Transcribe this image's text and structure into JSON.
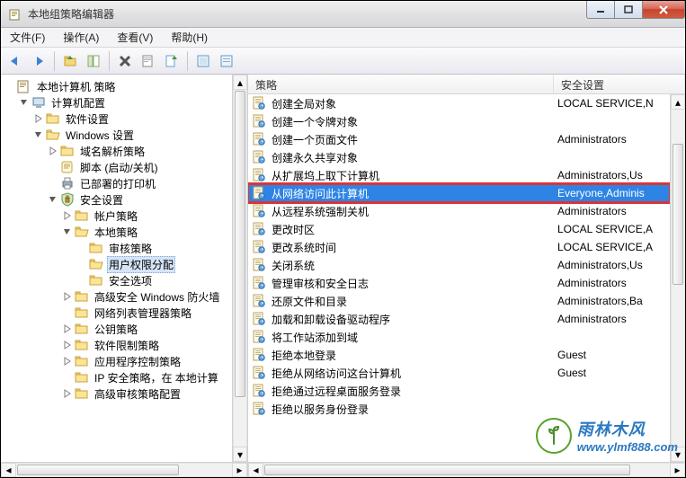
{
  "window": {
    "title": "本地组策略编辑器"
  },
  "menu": {
    "file": "文件(F)",
    "action": "操作(A)",
    "view": "查看(V)",
    "help": "帮助(H)"
  },
  "tree": {
    "root": "本地计算机 策略",
    "computer_config": "计算机配置",
    "software_settings": "软件设置",
    "windows_settings": "Windows 设置",
    "dns_policy": "域名解析策略",
    "scripts": "脚本 (启动/关机)",
    "printers": "已部署的打印机",
    "security": "安全设置",
    "account_policies": "帐户策略",
    "local_policies": "本地策略",
    "audit_policy": "审核策略",
    "user_rights": "用户权限分配",
    "security_options": "安全选项",
    "adv_firewall": "高级安全 Windows 防火墙",
    "nlm": "网络列表管理器策略",
    "public_key": "公钥策略",
    "software_restrict": "软件限制策略",
    "app_control": "应用程序控制策略",
    "ipsec": "IP 安全策略，在 本地计算",
    "adv_audit": "高级审核策略配置"
  },
  "columns": {
    "policy": "策略",
    "security_setting": "安全设置"
  },
  "policies": [
    {
      "name": "创建全局对象",
      "setting": "LOCAL SERVICE,N"
    },
    {
      "name": "创建一个令牌对象",
      "setting": ""
    },
    {
      "name": "创建一个页面文件",
      "setting": "Administrators"
    },
    {
      "name": "创建永久共享对象",
      "setting": ""
    },
    {
      "name": "从扩展坞上取下计算机",
      "setting": "Administrators,Us"
    },
    {
      "name": "从网络访问此计算机",
      "setting": "Everyone,Adminis",
      "selected": true
    },
    {
      "name": "从远程系统强制关机",
      "setting": "Administrators"
    },
    {
      "name": "更改时区",
      "setting": "LOCAL SERVICE,A"
    },
    {
      "name": "更改系统时间",
      "setting": "LOCAL SERVICE,A"
    },
    {
      "name": "关闭系统",
      "setting": "Administrators,Us"
    },
    {
      "name": "管理审核和安全日志",
      "setting": "Administrators"
    },
    {
      "name": "还原文件和目录",
      "setting": "Administrators,Ba"
    },
    {
      "name": "加载和卸载设备驱动程序",
      "setting": "Administrators"
    },
    {
      "name": "将工作站添加到域",
      "setting": ""
    },
    {
      "name": "拒绝本地登录",
      "setting": "Guest"
    },
    {
      "name": "拒绝从网络访问这台计算机",
      "setting": "Guest"
    },
    {
      "name": "拒绝通过远程桌面服务登录",
      "setting": ""
    },
    {
      "name": "拒绝以服务身份登录",
      "setting": ""
    }
  ],
  "watermark": {
    "cn": "雨林木风",
    "url": "www.ylmf888.com"
  }
}
